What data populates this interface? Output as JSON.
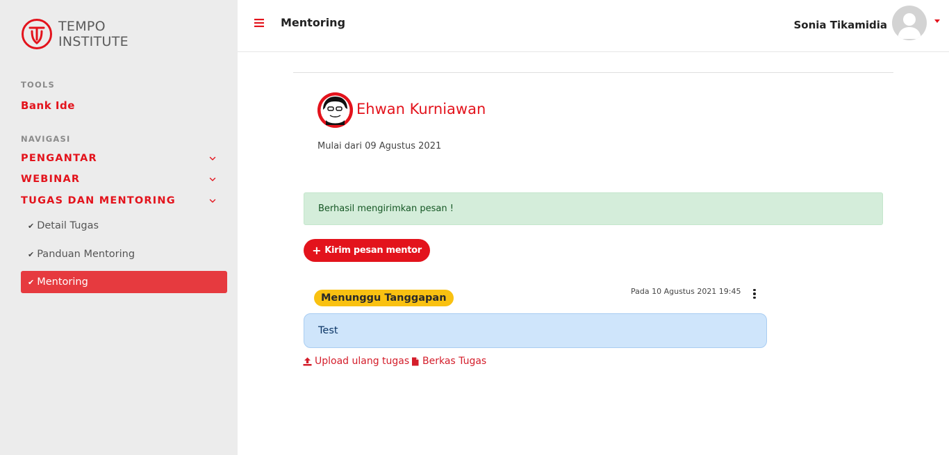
{
  "brand": {
    "line1": "TEMPO",
    "line2": "INSTITUTE"
  },
  "sidebar": {
    "tools_label": "TOOLS",
    "tools_item": "Bank Ide",
    "nav_label": "NAVIGASI",
    "nav": [
      {
        "label": "PENGANTAR"
      },
      {
        "label": "WEBINAR"
      },
      {
        "label": "TUGAS DAN MENTORING"
      }
    ],
    "sub": [
      {
        "label": "Detail Tugas"
      },
      {
        "label": "Panduan Mentoring"
      },
      {
        "label": "Mentoring",
        "active": true
      }
    ]
  },
  "header": {
    "title": "Mentoring",
    "user": "Sonia Tikamidia"
  },
  "mentor": {
    "name": "Ehwan Kurniawan",
    "since": "Mulai dari 09 Agustus 2021"
  },
  "alert": {
    "text": "Berhasil mengirimkan pesan !"
  },
  "actions": {
    "send_button": "Kirim pesan mentor",
    "reupload": "Upload ulang tugas",
    "files": "Berkas Tugas"
  },
  "message": {
    "status": "Menunggu Tanggapan",
    "date": "Pada 10 Agustus 2021 19:45",
    "text": "Test"
  },
  "colors": {
    "accent": "#e3131c",
    "sidebar_bg": "#ececec",
    "active_bg": "#e63a3f",
    "badge": "#f9c111",
    "bubble": "#cfe5fb",
    "alert_bg": "#d4edda"
  }
}
